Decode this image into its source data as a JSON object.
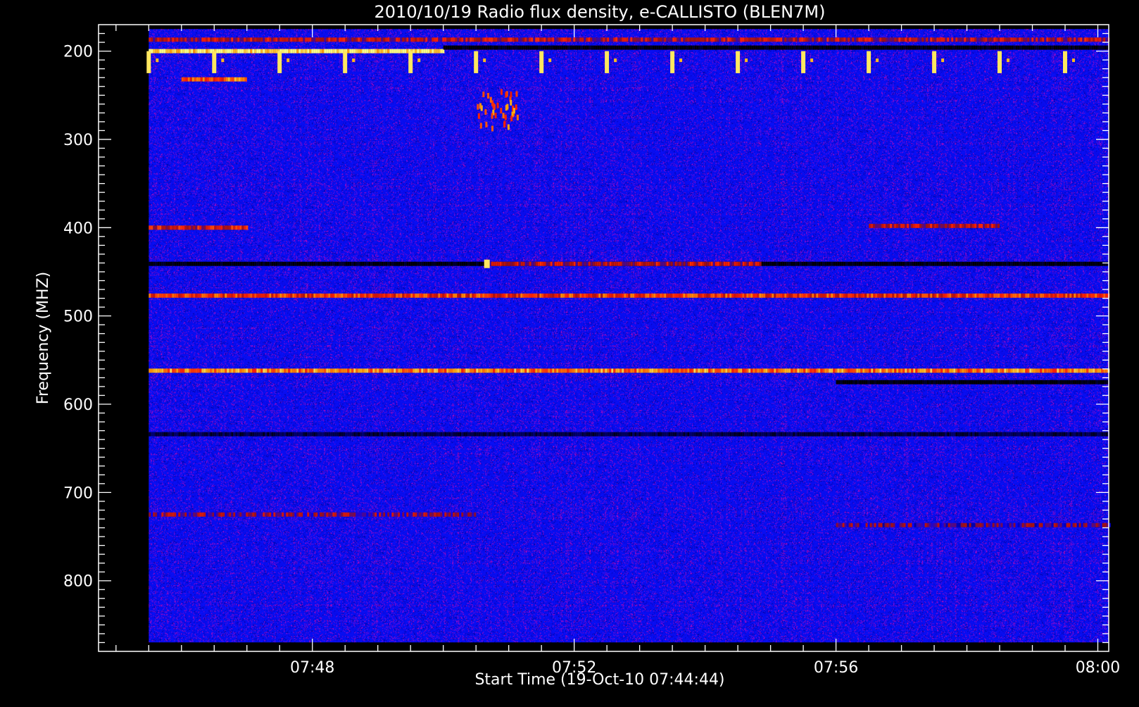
{
  "chart_data": {
    "type": "heatmap",
    "title": "2010/10/19  Radio flux density, e-CALLISTO (BLEN7M)",
    "xlabel": "Start Time (19-Oct-10 07:44:44)",
    "ylabel": "Frequency (MHZ)",
    "x_tick_labels": [
      "07:48",
      "07:52",
      "07:56",
      "08:00"
    ],
    "y_tick_labels": [
      "200",
      "300",
      "400",
      "500",
      "600",
      "700",
      "800"
    ],
    "xlim": [
      "07:44:44",
      "08:00:10"
    ],
    "ylim": [
      880,
      170
    ],
    "data_range_time": [
      "07:45:30",
      "08:00:10"
    ],
    "data_range_freq_mhz": [
      175,
      870
    ],
    "y_axis_inverted": true,
    "colormap": [
      "#000000",
      "#0000ff",
      "#a01010",
      "#ff2000",
      "#ffa000",
      "#ffff80"
    ],
    "background_color": "#0a0af0",
    "features": [
      {
        "kind": "band",
        "freq_mhz": 200,
        "t_start": "07:45:30",
        "t_end": "07:50:00",
        "intensity": 0.95
      },
      {
        "kind": "band",
        "freq_mhz": 196,
        "t_start": "07:50:00",
        "t_end": "08:00:10",
        "intensity": 0.0
      },
      {
        "kind": "band",
        "freq_mhz": 187,
        "t_start": "07:45:30",
        "t_end": "08:00:10",
        "intensity": 0.45
      },
      {
        "kind": "band",
        "freq_mhz": 232,
        "t_start": "07:46:00",
        "t_end": "07:47:00",
        "intensity": 0.7
      },
      {
        "kind": "band",
        "freq_mhz": 400,
        "t_start": "07:45:30",
        "t_end": "07:47:00",
        "intensity": 0.5
      },
      {
        "kind": "band",
        "freq_mhz": 398,
        "t_start": "07:56:30",
        "t_end": "07:58:30",
        "intensity": 0.45
      },
      {
        "kind": "band",
        "freq_mhz": 441,
        "t_start": "07:45:30",
        "t_end": "08:00:10",
        "intensity": 0.0
      },
      {
        "kind": "band",
        "freq_mhz": 441,
        "t_start": "07:50:40",
        "t_end": "07:54:50",
        "intensity": 0.45
      },
      {
        "kind": "band",
        "freq_mhz": 477,
        "t_start": "07:45:30",
        "t_end": "08:00:10",
        "intensity": 0.6
      },
      {
        "kind": "band",
        "freq_mhz": 562,
        "t_start": "07:45:30",
        "t_end": "08:00:10",
        "intensity": 0.75
      },
      {
        "kind": "band",
        "freq_mhz": 575,
        "t_start": "07:56:00",
        "t_end": "08:00:10",
        "intensity": 0.0
      },
      {
        "kind": "band",
        "freq_mhz": 634,
        "t_start": "07:45:30",
        "t_end": "08:00:10",
        "intensity": 0.05
      },
      {
        "kind": "band",
        "freq_mhz": 725,
        "t_start": "07:45:30",
        "t_end": "07:50:30",
        "intensity": 0.35
      },
      {
        "kind": "band",
        "freq_mhz": 737,
        "t_start": "07:56:00",
        "t_end": "08:00:10",
        "intensity": 0.3
      },
      {
        "kind": "burst",
        "freq_mhz": [
          240,
          285
        ],
        "t_start": "07:50:30",
        "t_end": "07:51:10",
        "intensity": 0.7
      },
      {
        "kind": "spot",
        "freq_mhz": 441,
        "t": "07:50:40",
        "intensity": 0.95
      }
    ],
    "periodic_spikes": {
      "freq_mhz": [
        200,
        225
      ],
      "first": "07:45:30",
      "period_s": 60,
      "count": 15,
      "intensity": 0.95
    }
  }
}
